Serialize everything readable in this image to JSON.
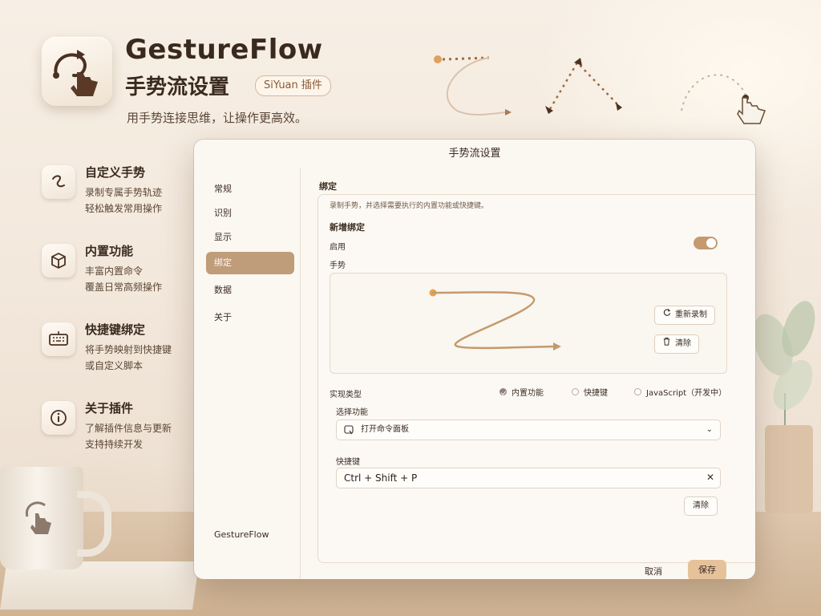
{
  "header": {
    "title": "GestureFlow",
    "subtitle": "手势流设置",
    "badge": "SiYuan 插件",
    "tagline": "用手势连接思维，让操作更高效。"
  },
  "features": [
    {
      "icon": "gesture-scribble-icon",
      "title": "自定义手势",
      "line1": "录制专属手势轨迹",
      "line2": "轻松触发常用操作"
    },
    {
      "icon": "box-icon",
      "title": "内置功能",
      "line1": "丰富内置命令",
      "line2": "覆盖日常高频操作"
    },
    {
      "icon": "keyboard-icon",
      "title": "快捷键绑定",
      "line1": "将手势映射到快捷键",
      "line2": "或自定义脚本"
    },
    {
      "icon": "info-icon",
      "title": "关于插件",
      "line1": "了解插件信息与更新",
      "line2": "支持持续开发"
    }
  ],
  "dialog": {
    "title": "手势流设置",
    "sidebar": {
      "items": [
        "常规",
        "识别",
        "显示",
        "绑定",
        "数据",
        "关于"
      ],
      "active": "绑定",
      "footer": "GestureFlow"
    },
    "section_title": "绑定",
    "panel_desc": "录制手势，并选择需要执行的内置功能或快捷键。",
    "new_binding": "新增绑定",
    "enable_label": "启用",
    "enabled": true,
    "gesture_label": "手势",
    "rerecord_label": "重新录制",
    "clear_gesture_label": "清除",
    "impl_type_label": "实现类型",
    "options": [
      {
        "label": "内置功能",
        "checked": true
      },
      {
        "label": "快捷键",
        "checked": false
      },
      {
        "label": "JavaScript（开发中）",
        "checked": false
      }
    ],
    "select_function_label": "选择功能",
    "select_function_value": "打开命令面板",
    "shortcut_label": "快捷键",
    "shortcut_value": "Ctrl + Shift + P",
    "clear_shortcut_label": "清除",
    "cancel_label": "取消",
    "save_label": "保存"
  },
  "colors": {
    "accent": "#bf9c7a",
    "save": "#e6c29b",
    "stroke": "#c49a6c"
  }
}
